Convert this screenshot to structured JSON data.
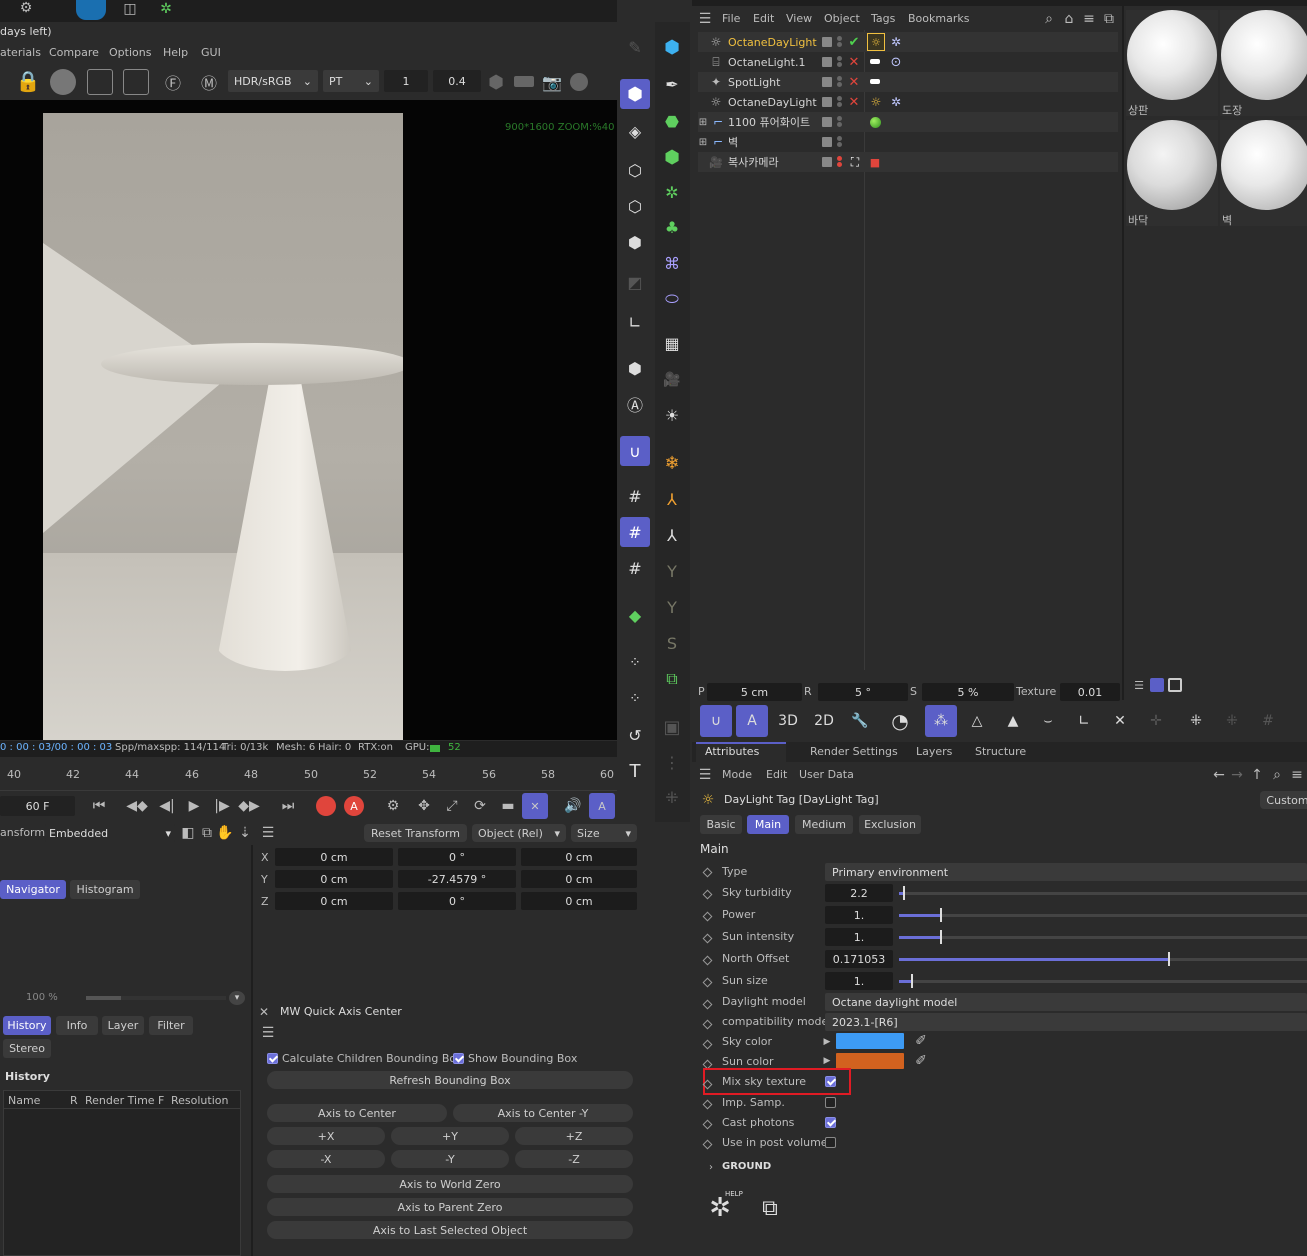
{
  "viewer": {
    "title_fragment": "days left)",
    "menu": [
      "aterials",
      "Compare",
      "Options",
      "Help",
      "GUI"
    ],
    "color_mode": "HDR/sRGB",
    "kernel": "PT",
    "value1": "1",
    "value2": "0.4",
    "overlay_text": "900*1600 ZOOM:%40",
    "status": {
      "time": "0 : 00 : 03/00 : 00 : 03",
      "spp": "Spp/maxspp: 114/114",
      "tri": "Tri: 0/13k",
      "mesh": "Mesh: 6",
      "hair": "Hair: 0",
      "rtx": "RTX:on",
      "gpu_label": "GPU:",
      "gpu_value": "52"
    }
  },
  "timeline": {
    "ticks": [
      "40",
      "42",
      "44",
      "46",
      "48",
      "50",
      "52",
      "54",
      "56",
      "58",
      "60"
    ],
    "frame": "60 F"
  },
  "transform": {
    "label": "ansform",
    "mode": "Embedded",
    "reset": "Reset Transform",
    "coord": "Object (Rel)",
    "size": "Size",
    "rows": [
      {
        "axis": "X",
        "pos": "0 cm",
        "rot": "0 °",
        "size": "0 cm"
      },
      {
        "axis": "Y",
        "pos": "0 cm",
        "rot": "-27.4579 °",
        "size": "0 cm"
      },
      {
        "axis": "Z",
        "pos": "0 cm",
        "rot": "0 °",
        "size": "0 cm"
      }
    ]
  },
  "navigator": {
    "tabs": [
      "Navigator",
      "Histogram"
    ],
    "zoom": "100 %"
  },
  "history_panel": {
    "tabs": [
      "History",
      "Info",
      "Layer",
      "Filter"
    ],
    "tab_stereo": "Stereo",
    "title": "History",
    "columns": [
      "Name",
      "R",
      "Render Time",
      "F",
      "Resolution"
    ]
  },
  "quick_axis": {
    "title": "MW Quick Axis Center",
    "calc_children": "Calculate Children Bounding Box",
    "show_bbox": "Show Bounding Box",
    "refresh": "Refresh Bounding Box",
    "axis_center": "Axis to Center",
    "axis_center_y": "Axis to Center -Y",
    "px": "+X",
    "py": "+Y",
    "pz": "+Z",
    "mx": "-X",
    "my": "-Y",
    "mz": "-Z",
    "world_zero": "Axis to World Zero",
    "parent_zero": "Axis to Parent Zero",
    "last_selected": "Axis to Last Selected Object"
  },
  "objects": {
    "menu": [
      "File",
      "Edit",
      "View",
      "Object",
      "Tags",
      "Bookmarks"
    ],
    "items": [
      {
        "name": "OctaneDayLight",
        "highlight": true
      },
      {
        "name": "OctaneLight.1",
        "highlight": false
      },
      {
        "name": "SpotLight",
        "highlight": false
      },
      {
        "name": "OctaneDayLight",
        "highlight": false
      },
      {
        "name": "1100 퓨어화이트",
        "highlight": false
      },
      {
        "name": "벽",
        "highlight": false
      },
      {
        "name": "복사카메라",
        "highlight": false
      }
    ]
  },
  "materials": [
    "상판",
    "도장",
    "바닥",
    "벽"
  ],
  "coord_bar": {
    "p_label": "P",
    "p_value": "5 cm",
    "r_label": "R",
    "r_value": "5 °",
    "s_label": "S",
    "s_value": "5 %",
    "texture_label": "Texture",
    "texture_value": "0.01"
  },
  "attributes": {
    "tabs": [
      "Attributes",
      "Render Settings",
      "Layers",
      "Structure"
    ],
    "menu": [
      "Mode",
      "Edit",
      "User Data"
    ],
    "title": "DayLight Tag [DayLight Tag]",
    "custom": "Custom",
    "subtabs": [
      "Basic",
      "Main",
      "Medium",
      "Exclusion"
    ],
    "section": "Main",
    "type_label": "Type",
    "type_value": "Primary environment",
    "sky_turbidity_label": "Sky turbidity",
    "sky_turbidity_value": "2.2",
    "sky_turbidity_frac": 0.01,
    "power_label": "Power",
    "power_value": "1.",
    "power_frac": 0.1,
    "sun_intensity_label": "Sun intensity",
    "sun_intensity_value": "1.",
    "sun_intensity_frac": 0.1,
    "north_offset_label": "North Offset",
    "north_offset_value": "0.171053",
    "north_offset_frac": 0.66,
    "sun_size_label": "Sun size",
    "sun_size_value": "1.",
    "sun_size_frac": 0.03,
    "daylight_model_label": "Daylight model",
    "daylight_model_value": "Octane daylight model",
    "compat_label": "compatibility mode",
    "compat_value": "2023.1-[R6]",
    "sky_color_label": "Sky color",
    "sky_color": "#3d9bf5",
    "sun_color_label": "Sun color",
    "sun_color": "#d2621f",
    "mix_sky_label": "Mix sky texture",
    "imp_samp_label": "Imp. Samp.",
    "cast_photons_label": "Cast photons",
    "post_volume_label": "Use in post volume",
    "ground_label": "GROUND",
    "help_label": "HELP"
  },
  "colors": {
    "accent": "#5b5fc7",
    "highlight_box": "#e01b24",
    "selected_name": "#f0c040"
  }
}
